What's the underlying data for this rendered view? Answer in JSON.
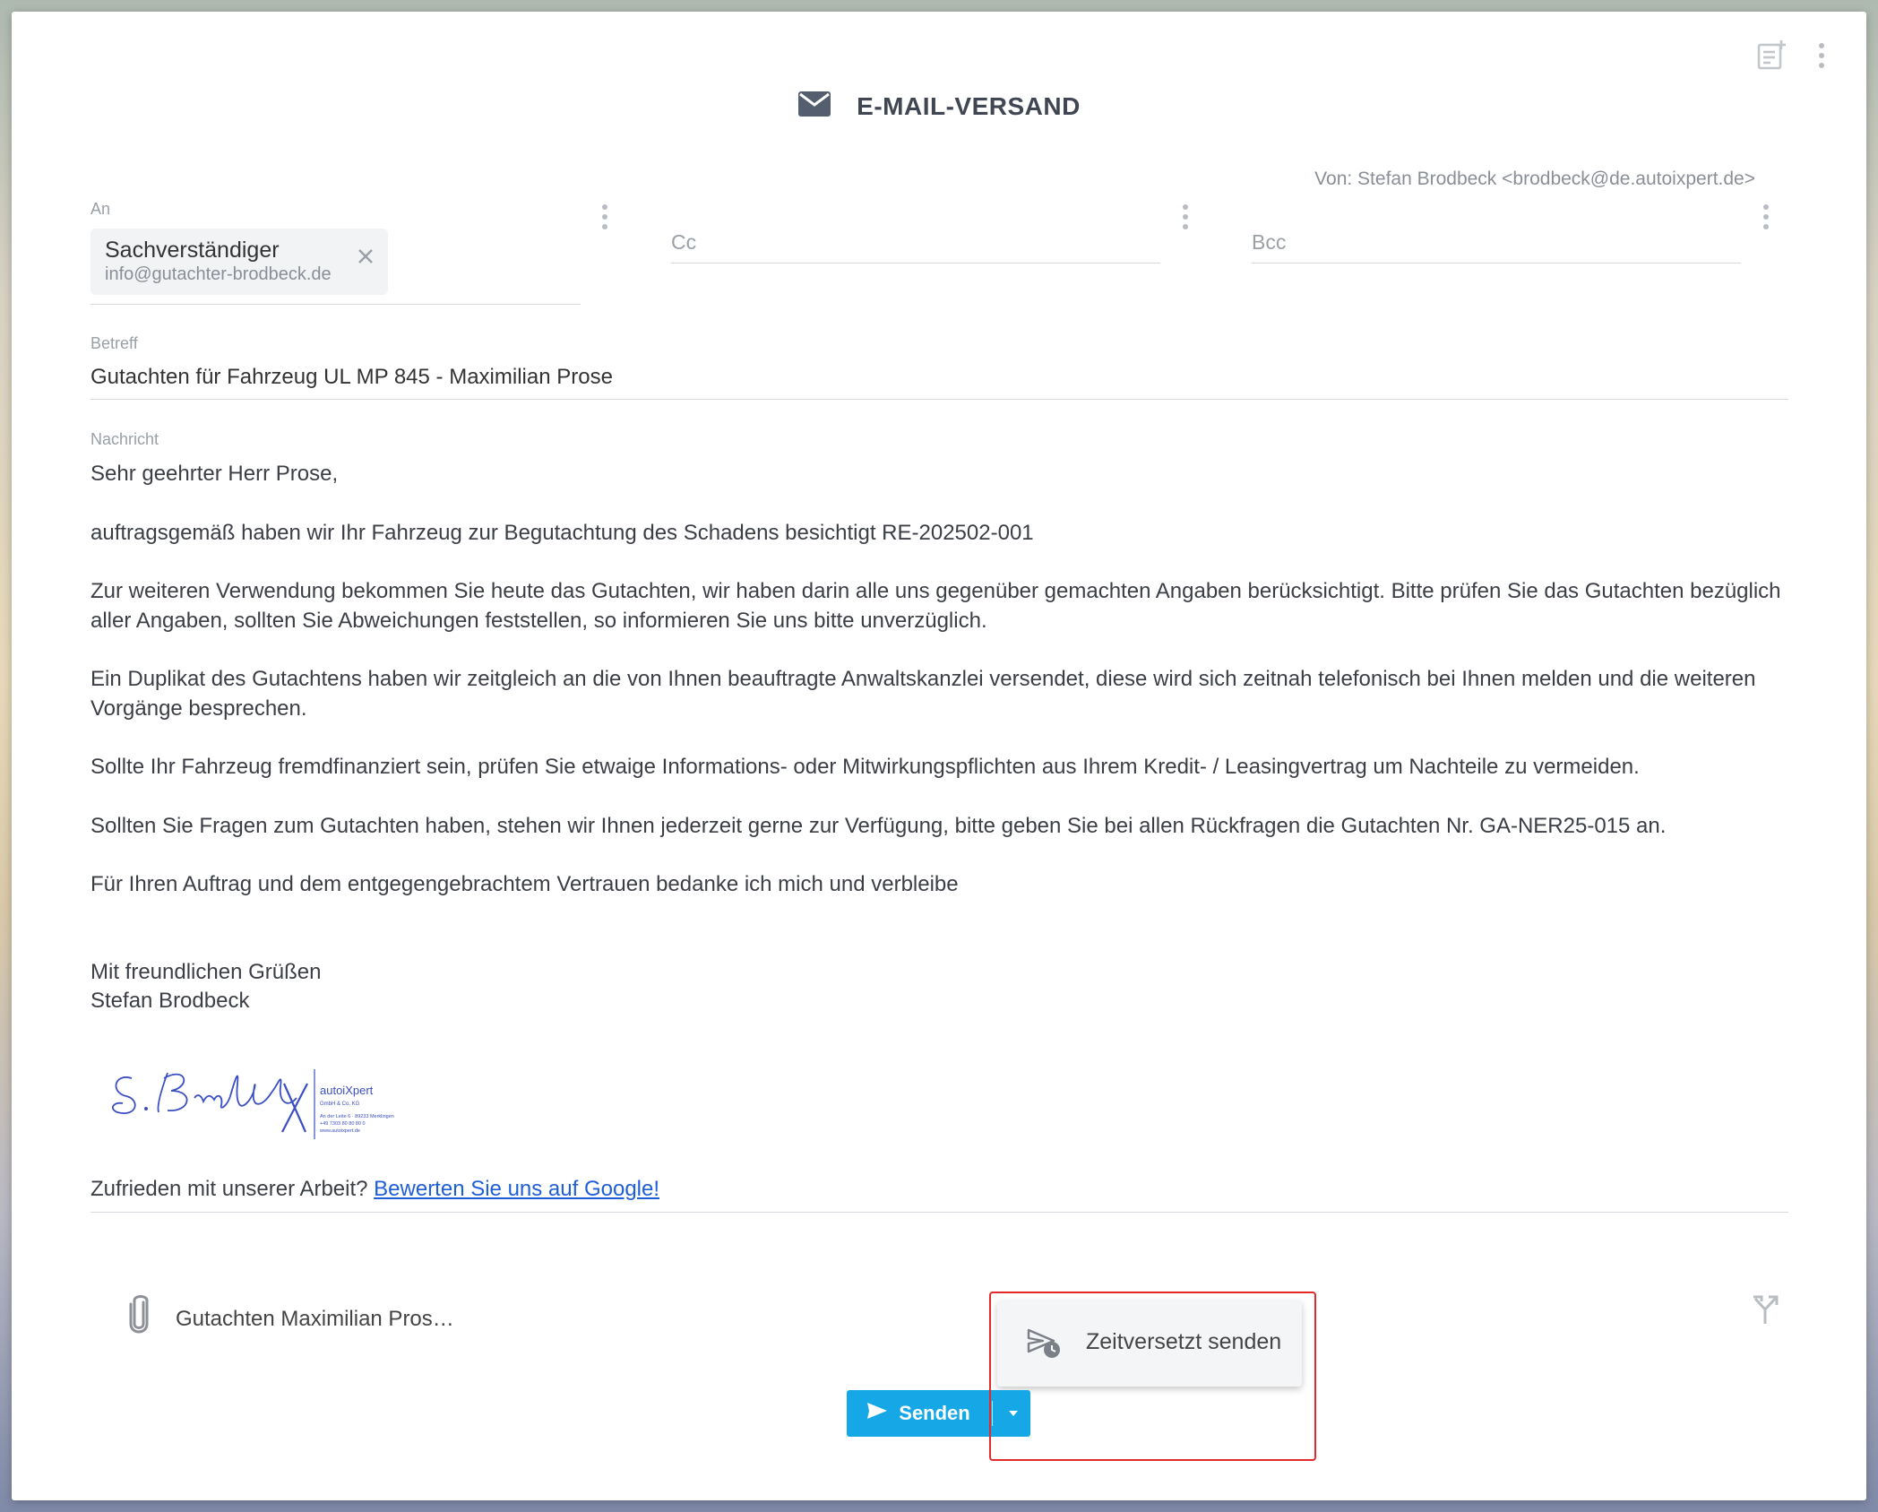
{
  "header": {
    "title": "E-MAIL-VERSAND",
    "title_icon": "envelope-icon",
    "top_icons": [
      "note-add-icon",
      "more-vertical-icon"
    ]
  },
  "from": "Von: Stefan Brodbeck <brodbeck@de.autoixpert.de>",
  "recipients": {
    "to_label": "An",
    "to_chip": {
      "name": "Sachverständiger",
      "email": "info@gutachter-brodbeck.de"
    },
    "cc_placeholder": "Cc",
    "bcc_placeholder": "Bcc"
  },
  "subject": {
    "label": "Betreff",
    "value": "Gutachten für Fahrzeug UL MP 845 - Maximilian Prose"
  },
  "message": {
    "label": "Nachricht",
    "greeting": "Sehr geehrter Herr Prose,",
    "p1": "auftragsgemäß haben wir Ihr Fahrzeug zur Begutachtung des Schadens besichtigt RE-202502-001",
    "p2": "Zur weiteren Verwendung bekommen Sie heute das Gutachten, wir haben darin alle uns gegenüber gemachten Angaben berücksichtigt. Bitte prüfen Sie das Gutachten bezüglich aller Angaben, sollten Sie Abweichungen feststellen, so informieren Sie uns bitte unverzüglich.",
    "p3": "Ein Duplikat des Gutachtens haben wir zeitgleich an die von Ihnen beauftragte Anwaltskanzlei versendet, diese wird sich zeitnah telefonisch bei Ihnen melden und die weiteren Vorgänge besprechen.",
    "p4": "Sollte Ihr Fahrzeug fremdfinanziert sein, prüfen Sie etwaige Informations- oder Mitwirkungspflichten aus Ihrem Kredit- / Leasingvertrag um Nachteile zu vermeiden.",
    "p5": "Sollten Sie Fragen zum Gutachten haben, stehen wir Ihnen jederzeit gerne zur Verfügung, bitte geben Sie bei allen Rückfragen die Gutachten Nr. GA-NER25-015 an.",
    "p6": "Für Ihren Auftrag und dem entgegengebrachtem Vertrauen bedanke ich mich und verbleibe",
    "closing": "Mit freundlichen Grüßen",
    "sender_name": "Stefan Brodbeck",
    "signature": {
      "company": "autoiXpert",
      "company_sub": "GmbH & Co. KG",
      "address": "An der Leite 6 · 89233 Merklingen",
      "phone": "+49 7303 80 80 80 0",
      "web": "www.autoixpert.de"
    },
    "review_prefix": "Zufrieden mit unserer Arbeit? ",
    "review_link": "Bewerten Sie uns auf Google!"
  },
  "attachment": {
    "name": "Gutachten Maximilian Pros…",
    "icon": "paperclip-icon"
  },
  "send": {
    "label": "Senden",
    "dropdown_option": "Zeitversetzt senden"
  },
  "colors": {
    "accent": "#15a7e6",
    "highlight": "#e32a2a",
    "link": "#1e5fd6"
  }
}
